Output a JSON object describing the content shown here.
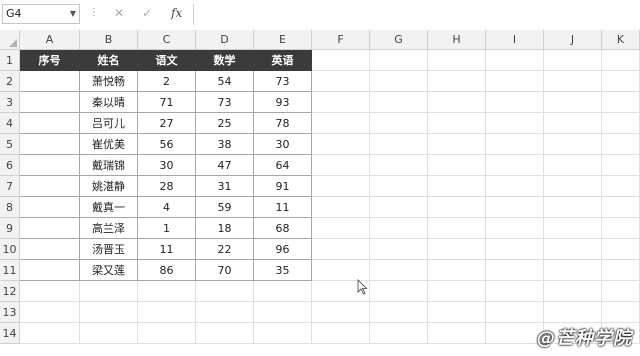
{
  "formula_bar": {
    "name_box": "G4",
    "cancel_icon": "✕",
    "enter_icon": "✓",
    "fx_label": "fx",
    "formula": ""
  },
  "sheet": {
    "columns": [
      "A",
      "B",
      "C",
      "D",
      "E",
      "F",
      "G",
      "H",
      "I",
      "J",
      "K"
    ],
    "rows": [
      "1",
      "2",
      "3",
      "4",
      "5",
      "6",
      "7",
      "8",
      "9",
      "10",
      "11",
      "12",
      "13",
      "14"
    ],
    "table_headers": [
      "序号",
      "姓名",
      "语文",
      "数学",
      "英语"
    ],
    "table_rows": [
      [
        "",
        "萧悦畅",
        "2",
        "54",
        "73"
      ],
      [
        "",
        "秦以晴",
        "71",
        "73",
        "93"
      ],
      [
        "",
        "吕可儿",
        "27",
        "25",
        "78"
      ],
      [
        "",
        "崔优美",
        "56",
        "38",
        "30"
      ],
      [
        "",
        "戴瑞锦",
        "30",
        "47",
        "64"
      ],
      [
        "",
        "姚湛静",
        "28",
        "31",
        "91"
      ],
      [
        "",
        "戴真一",
        "4",
        "59",
        "11"
      ],
      [
        "",
        "高兰泽",
        "1",
        "18",
        "68"
      ],
      [
        "",
        "汤晋玉",
        "11",
        "22",
        "96"
      ],
      [
        "",
        "梁又莲",
        "86",
        "70",
        "35"
      ]
    ],
    "selected_cell": "G4",
    "header_bg": "#3b3b3b"
  },
  "watermark": "@芒种学院"
}
